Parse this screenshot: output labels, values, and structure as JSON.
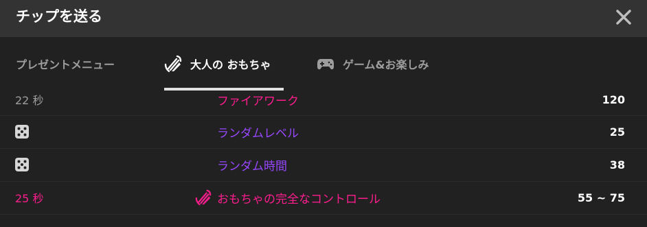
{
  "header": {
    "title": "チップを送る"
  },
  "tabs": [
    {
      "label": "プレゼントメニュー",
      "icon": "none",
      "active": false
    },
    {
      "label": "大人の おもちゃ",
      "icon": "toy-icon",
      "active": true
    },
    {
      "label": "ゲーム&お楽しみ",
      "icon": "gamepad-icon",
      "active": false
    }
  ],
  "colors": {
    "pink": "#ff1d8e",
    "purple": "#9747ff",
    "gray": "#9e9e9e",
    "header_bg": "#333333",
    "body_bg": "#212121"
  },
  "items": [
    {
      "lead": "22 秒",
      "name": "ファイアワーク",
      "amount": "120",
      "lead_icon": "none"
    },
    {
      "lead": "",
      "name": "ランダムレベル",
      "amount": "25",
      "lead_icon": "dice-icon"
    },
    {
      "lead": "",
      "name": "ランダム時間",
      "amount": "38",
      "lead_icon": "dice-icon"
    },
    {
      "lead": "25 秒",
      "name": "おもちゃの完全なコントロール",
      "amount": "55 ~ 75",
      "lead_icon": "none",
      "name_icon": "toy-icon"
    }
  ]
}
